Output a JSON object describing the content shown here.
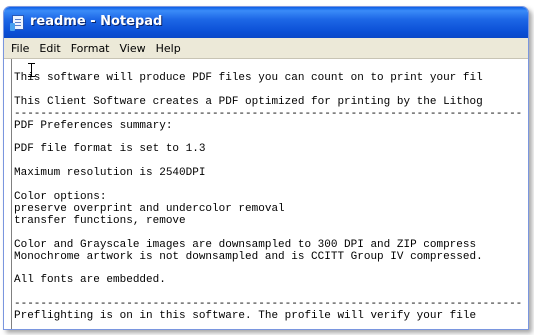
{
  "window": {
    "title": "readme - Notepad",
    "app_icon": "notepad-icon"
  },
  "menubar": {
    "items": [
      "File",
      "Edit",
      "Format",
      "View",
      "Help"
    ]
  },
  "editor": {
    "cursor_icon": "text-cursor-ibeam-icon",
    "text": "This software will produce PDF files you can count on to print your fil\n\nThis Client Software creates a PDF optimized for printing by the Lithog\n-----------------------------------------------------------------------------\nPDF Preferences summary:\n\nPDF file format is set to 1.3\n\nMaximum resolution is 2540DPI\n\nColor options:\npreserve overprint and undercolor removal\ntransfer functions, remove\n\nColor and Grayscale images are downsampled to 300 DPI and ZIP compress\nMonochrome artwork is not downsampled and is CCITT Group IV compressed.\n\nAll fonts are embedded.\n\n-----------------------------------------------------------------------------\nPreflighting is on in this software. The profile will verify your file"
  }
}
